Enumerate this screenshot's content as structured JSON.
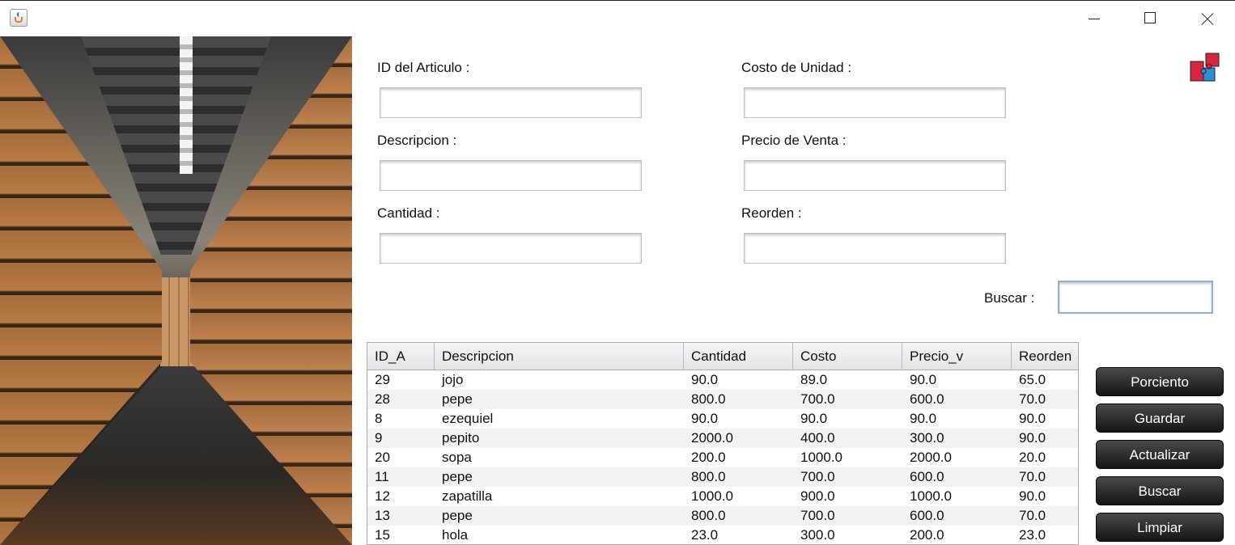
{
  "window": {
    "app_icon": "java-cup-icon",
    "controls": [
      "minimize-icon",
      "maximize-icon",
      "close-icon"
    ]
  },
  "form": {
    "id_label": "ID del Articulo :",
    "costo_label": "Costo de Unidad :",
    "descripcion_label": "Descripcion :",
    "precio_label": "Precio de Venta :",
    "cantidad_label": "Cantidad :",
    "reorden_label": "Reorden :",
    "id_value": "",
    "costo_value": "",
    "descripcion_value": "",
    "precio_value": "",
    "cantidad_value": "",
    "reorden_value": ""
  },
  "search": {
    "label": "Buscar :",
    "value": ""
  },
  "table": {
    "columns": [
      "ID_A",
      "Descripcion",
      "Cantidad",
      "Costo",
      "Precio_v",
      "Reorden"
    ],
    "rows": [
      [
        "29",
        "jojo",
        "90.0",
        "89.0",
        "90.0",
        "65.0"
      ],
      [
        "28",
        "pepe",
        "800.0",
        "700.0",
        "600.0",
        "70.0"
      ],
      [
        "8",
        "ezequiel",
        "90.0",
        "90.0",
        "90.0",
        "90.0"
      ],
      [
        "9",
        "pepito",
        "2000.0",
        "400.0",
        "300.0",
        "90.0"
      ],
      [
        "20",
        "sopa",
        "200.0",
        "1000.0",
        "2000.0",
        "20.0"
      ],
      [
        "11",
        "pepe",
        "800.0",
        "700.0",
        "600.0",
        "70.0"
      ],
      [
        "12",
        "zapatilla",
        "1000.0",
        "900.0",
        "1000.0",
        "90.0"
      ],
      [
        "13",
        "pepe",
        "800.0",
        "700.0",
        "600.0",
        "70.0"
      ],
      [
        "15",
        "hola",
        "23.0",
        "300.0",
        "200.0",
        "23.0"
      ]
    ]
  },
  "buttons": {
    "porciento": "Porciento",
    "guardar": "Guardar",
    "actualizar": "Actualizar",
    "buscar": "Buscar",
    "limpiar": "Limpiar"
  },
  "colors": {
    "button_bg": "#1e1e1e",
    "button_text": "#ffffff",
    "search_border": "#8fb0cf"
  }
}
